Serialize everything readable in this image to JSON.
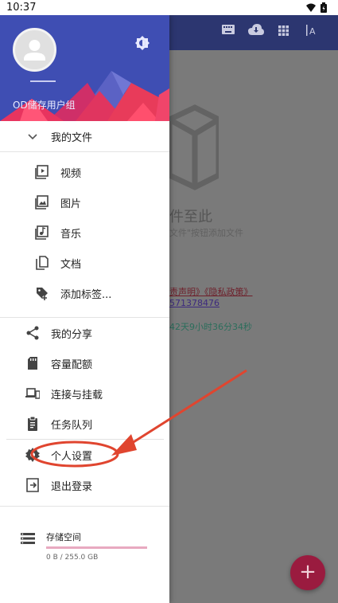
{
  "status_bar": {
    "time": "10:37"
  },
  "drawer": {
    "group_name": "OD储存用户组",
    "sections": {
      "my_files": "我的文件",
      "file_items": [
        {
          "label": "视频",
          "icon": "video-icon"
        },
        {
          "label": "图片",
          "icon": "image-icon"
        },
        {
          "label": "音乐",
          "icon": "music-icon"
        },
        {
          "label": "文档",
          "icon": "document-icon"
        },
        {
          "label": "添加标签...",
          "icon": "add-tag-icon"
        }
      ],
      "main_items": [
        {
          "label": "我的分享",
          "icon": "share-icon"
        },
        {
          "label": "容量配额",
          "icon": "sd-card-icon"
        },
        {
          "label": "连接与挂载",
          "icon": "devices-icon"
        },
        {
          "label": "任务队列",
          "icon": "clipboard-icon"
        }
      ],
      "settings_items": [
        {
          "label": "个人设置",
          "icon": "gear-icon"
        },
        {
          "label": "退出登录",
          "icon": "logout-icon"
        }
      ]
    },
    "storage": {
      "label": "存储空间",
      "amount": "0 B / 255.0 GB",
      "used_fraction": 0.0
    }
  },
  "background": {
    "empty_title": "件至此",
    "empty_sub": "文件\"按钮添加文件",
    "links": "责声明》《隐私政策》",
    "phone": "571378476",
    "timer": "42天9小时36分34秒"
  },
  "colors": {
    "header": "#3f4eb3",
    "annotation": "#e0452f",
    "fab": "#9a1b3f"
  }
}
